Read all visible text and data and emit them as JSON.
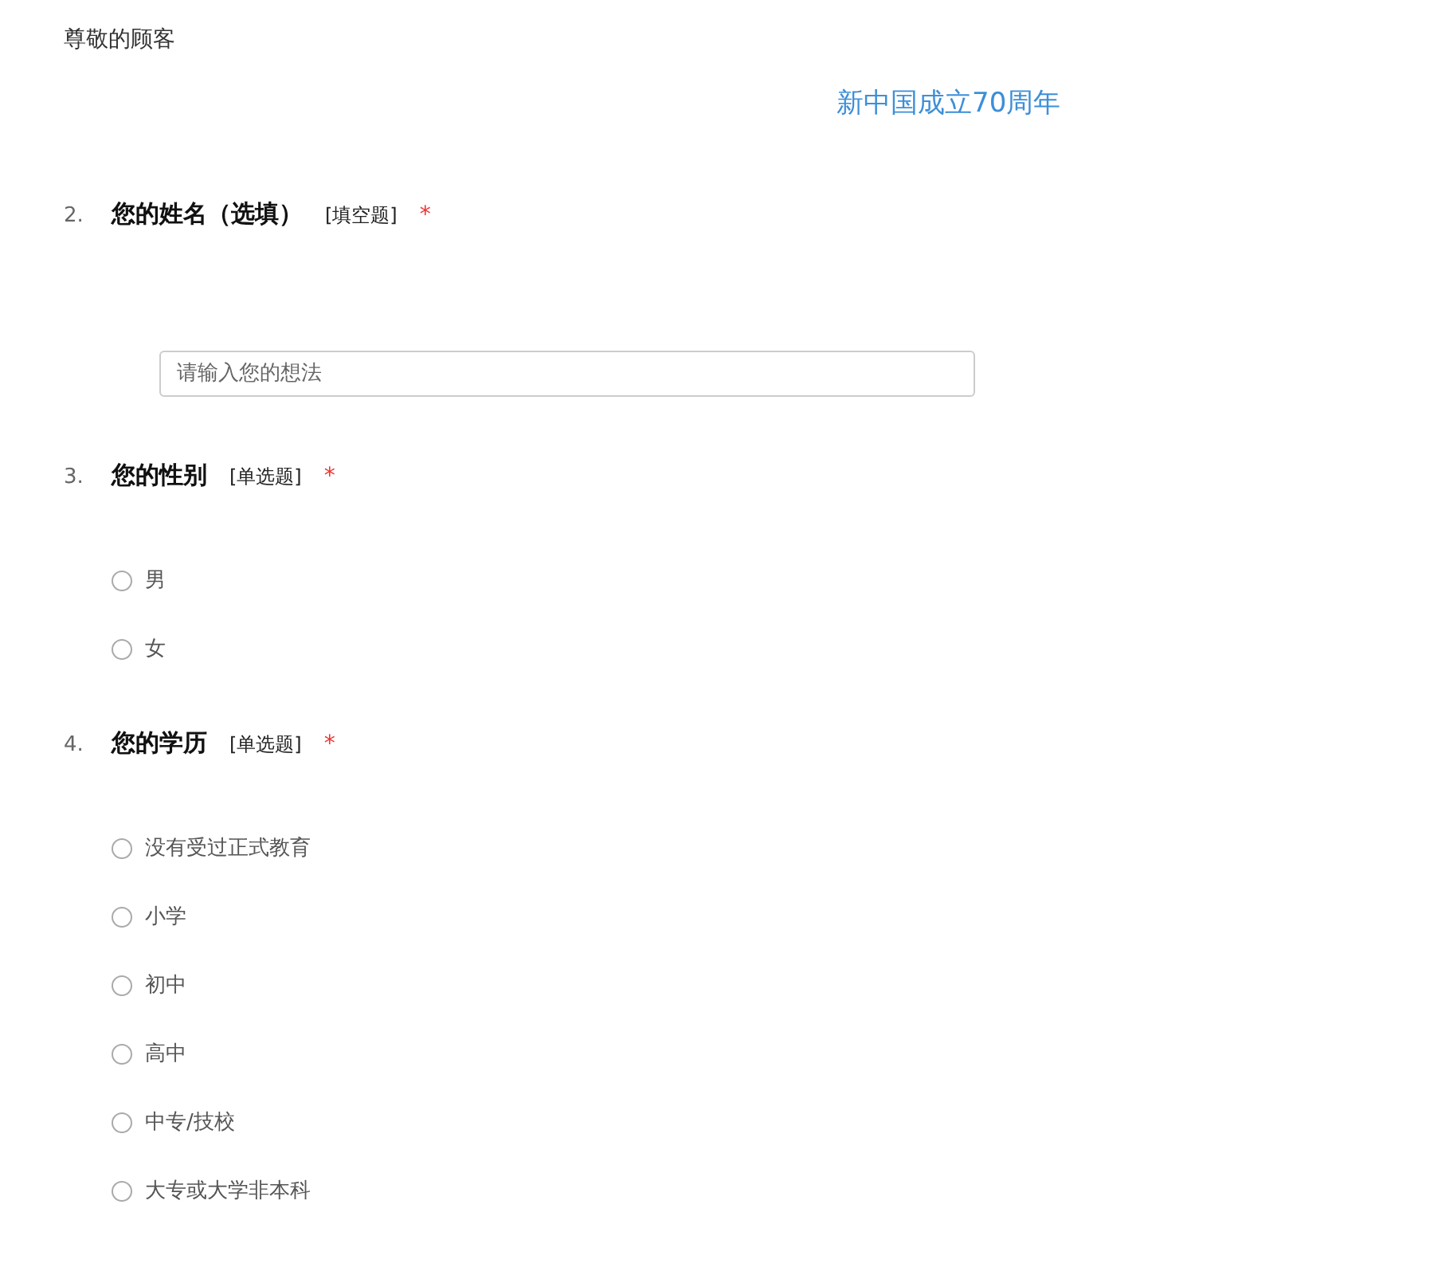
{
  "greeting": "尊敬的顾客",
  "title": "新中国成立70周年",
  "questions": [
    {
      "kind": "text",
      "number": "2.",
      "title": "您的姓名（选填）",
      "type": "[填空题]",
      "required_mark": "*",
      "placeholder": "请输入您的想法"
    },
    {
      "kind": "radio",
      "number": "3.",
      "title": "您的性别",
      "type": "[单选题]",
      "required_mark": "*",
      "options": [
        {
          "label": "男",
          "selected": false
        },
        {
          "label": "女",
          "selected": false
        }
      ]
    },
    {
      "kind": "radio",
      "number": "4.",
      "title": "您的学历",
      "type": "[单选题]",
      "required_mark": "*",
      "options": [
        {
          "label": "没有受过正式教育",
          "selected": false
        },
        {
          "label": "小学",
          "selected": false
        },
        {
          "label": "初中",
          "selected": false
        },
        {
          "label": "高中",
          "selected": false
        },
        {
          "label": "中专/技校",
          "selected": false
        },
        {
          "label": "大专或大学非本科",
          "selected": false
        }
      ]
    }
  ]
}
